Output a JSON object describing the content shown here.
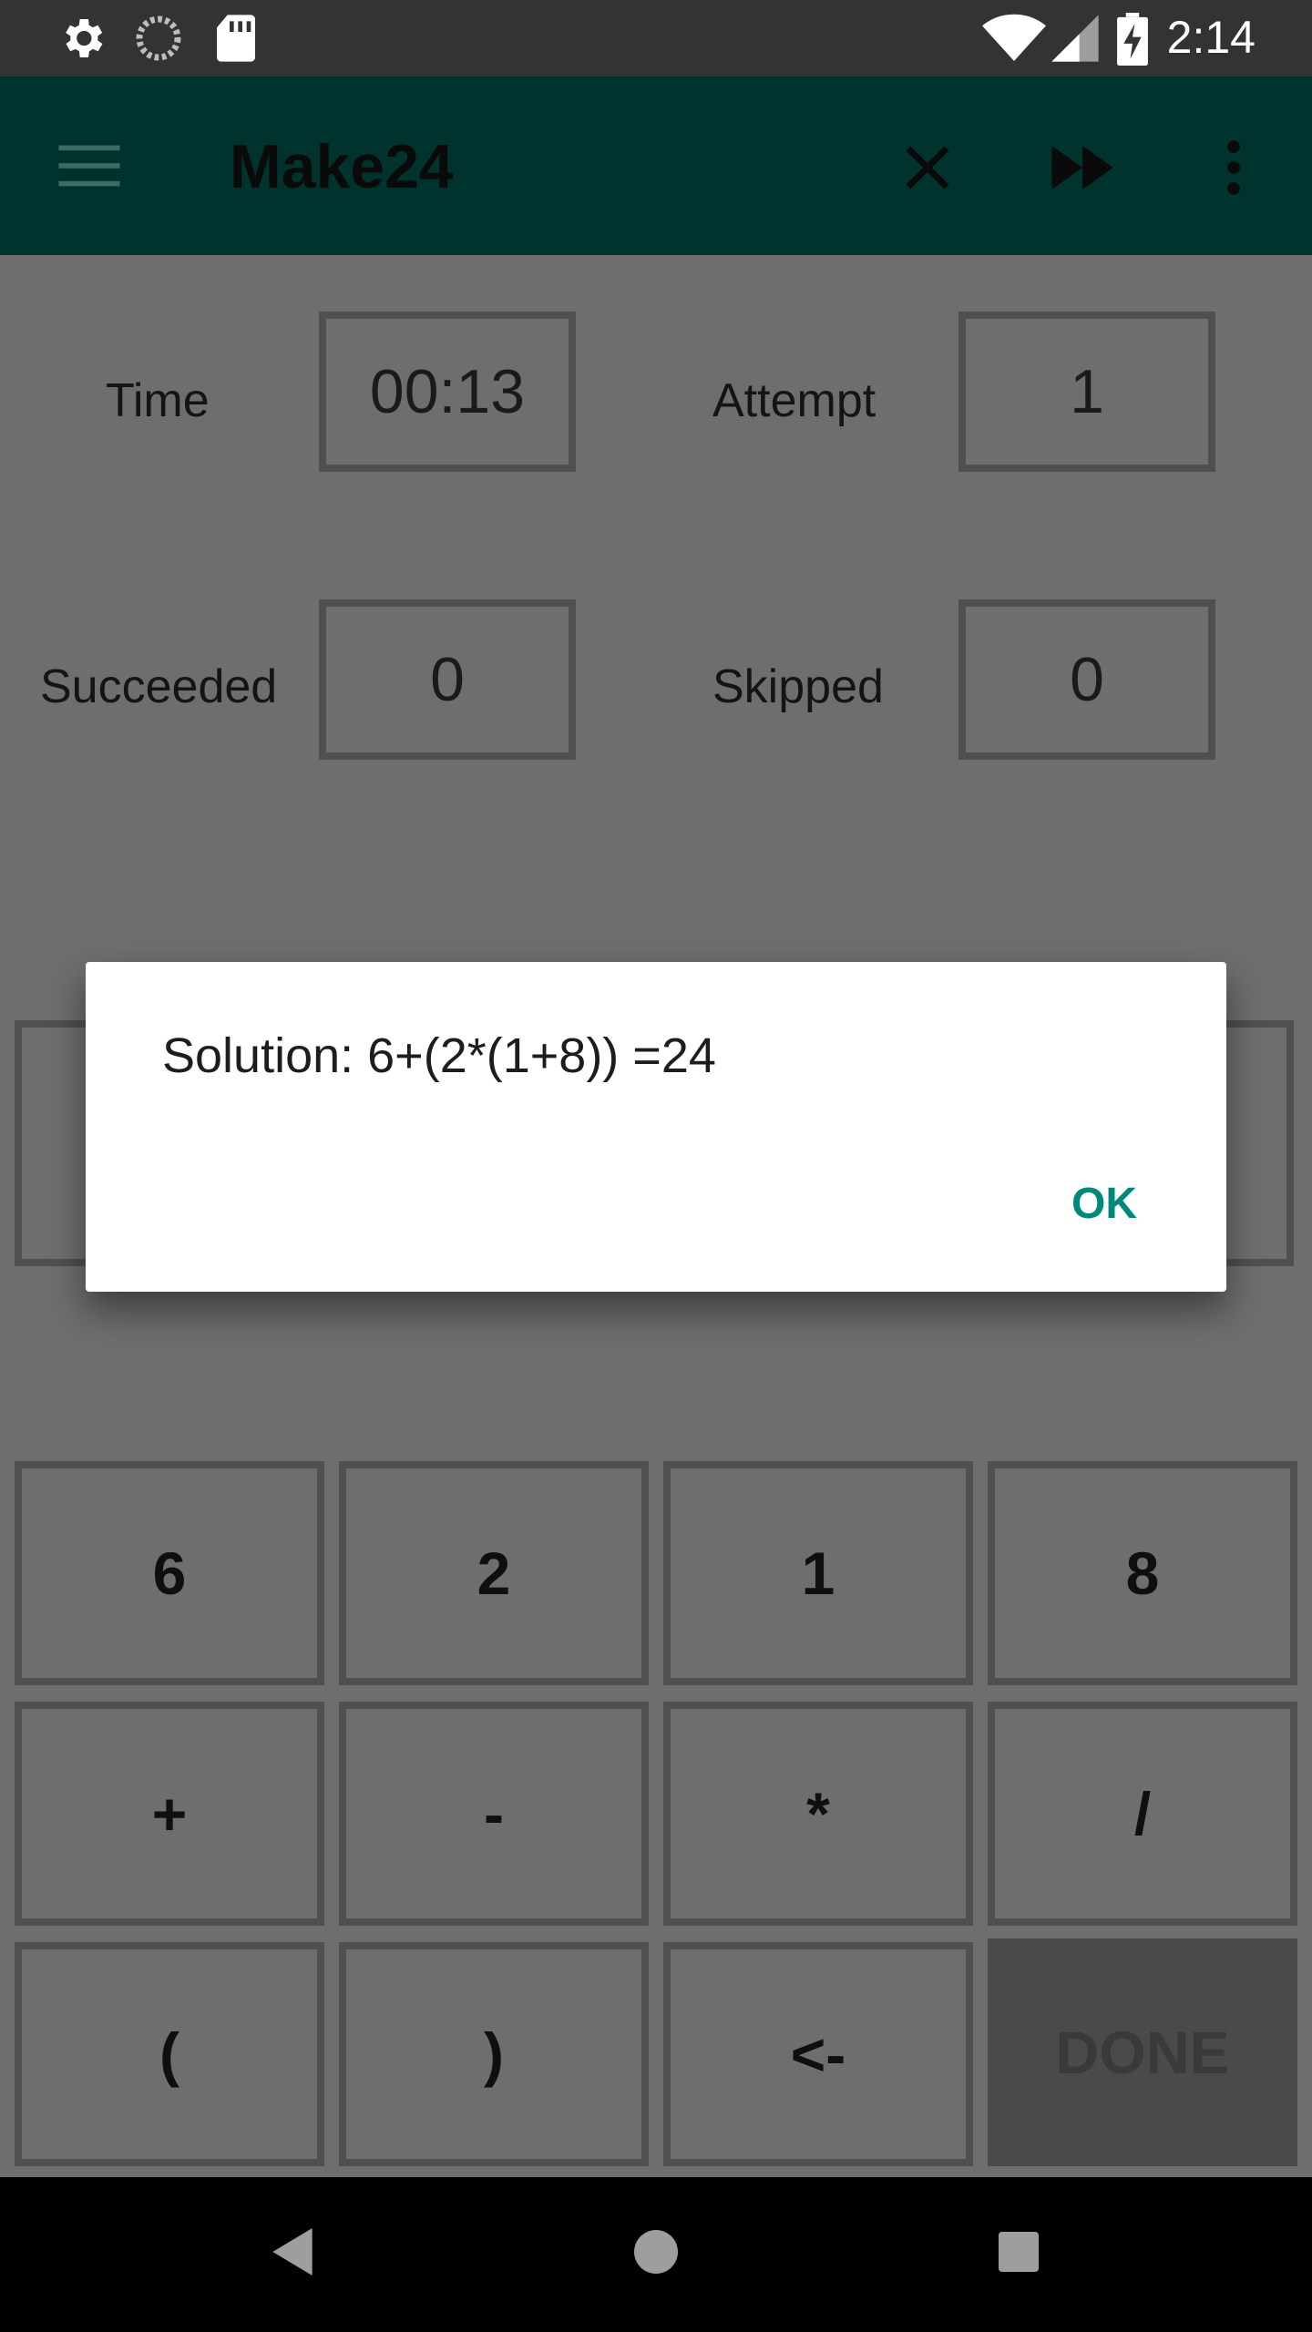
{
  "status_bar": {
    "time": "2:14",
    "left_icons": [
      "settings-icon",
      "sync-icon",
      "sd-card-icon"
    ],
    "right_icons": [
      "wifi-icon",
      "signal-icon",
      "battery-charging-icon"
    ]
  },
  "app_bar": {
    "title": "Make24",
    "actions": [
      "close-icon",
      "skip-forward-icon",
      "more-vert-icon"
    ],
    "color": "#00332e"
  },
  "stats": {
    "time_label": "Time",
    "time_value": "00:13",
    "attempt_label": "Attempt",
    "attempt_value": "1",
    "succeeded_label": "Succeeded",
    "succeeded_value": "0",
    "skipped_label": "Skipped",
    "skipped_value": "0"
  },
  "keypad": {
    "numbers": [
      "6",
      "2",
      "1",
      "8"
    ],
    "operators": [
      "+",
      "-",
      "*",
      "/"
    ],
    "row3": [
      "(",
      ")",
      "<-"
    ],
    "done_label": "DONE"
  },
  "dialog": {
    "message": "Solution: 6+(2*(1+8)) =24",
    "ok_label": "OK",
    "accent": "#00897b"
  },
  "nav_bar": {
    "icons": [
      "back-icon",
      "home-icon",
      "recents-icon"
    ]
  }
}
